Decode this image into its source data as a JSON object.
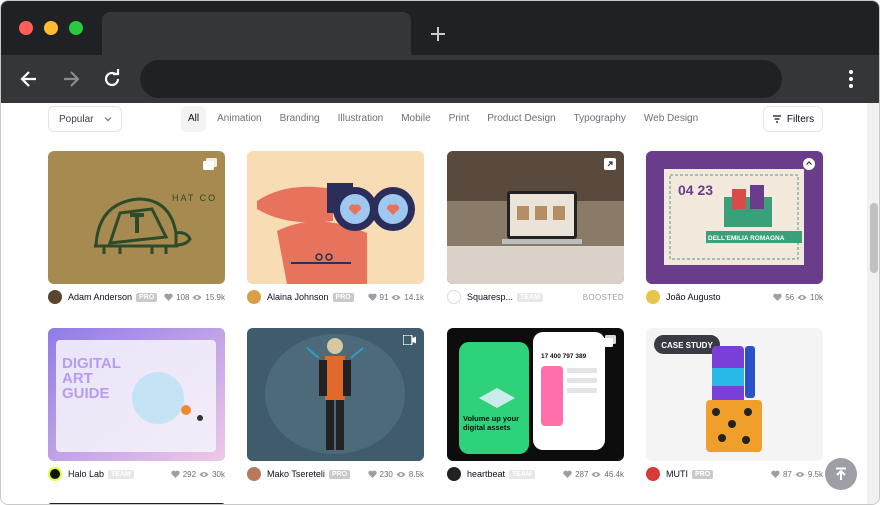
{
  "filters_bar": {
    "sort_value": "Popular",
    "categories": [
      "All",
      "Animation",
      "Branding",
      "Illustration",
      "Mobile",
      "Print",
      "Product Design",
      "Typography",
      "Web Design"
    ],
    "filters_label": "Filters"
  },
  "shots": [
    {
      "author": "Adam Anderson",
      "tag": "PRO",
      "likes": "108",
      "views": "15.9k",
      "bg": "#a68a4f",
      "art": "HAT CO"
    },
    {
      "author": "Alaina Johnson",
      "tag": "PRO",
      "likes": "91",
      "views": "14.1k",
      "bg": "#f7dcb4"
    },
    {
      "author": "Squaresp...",
      "tag": "TEAM",
      "boosted": "BOOSTED",
      "bg": "#6e5f52"
    },
    {
      "author": "João Augusto",
      "likes": "56",
      "views": "10k",
      "bg": "#6a3d8c",
      "art": "04 23",
      "art2": "DELL'EMILIA ROMAGNA"
    },
    {
      "author": "Halo Lab",
      "tag": "TEAM",
      "likes": "292",
      "views": "30k",
      "bg": "#c9b9f2",
      "art": "DIGITAL ART GUIDE"
    },
    {
      "author": "Mako Tsereteli",
      "tag": "PRO",
      "likes": "230",
      "views": "8.5k",
      "bg": "#3f5a6a"
    },
    {
      "author": "heartbeat",
      "tag": "TEAM",
      "likes": "287",
      "views": "46.4k",
      "bg": "#0d0d0d",
      "art": "Volume up your digital assets",
      "art2": "17 400 797 389"
    },
    {
      "author": "MUTI",
      "tag": "PRO",
      "likes": "87",
      "views": "9.5k",
      "bg": "#f4f4f5",
      "art": "CASE STUDY"
    }
  ]
}
